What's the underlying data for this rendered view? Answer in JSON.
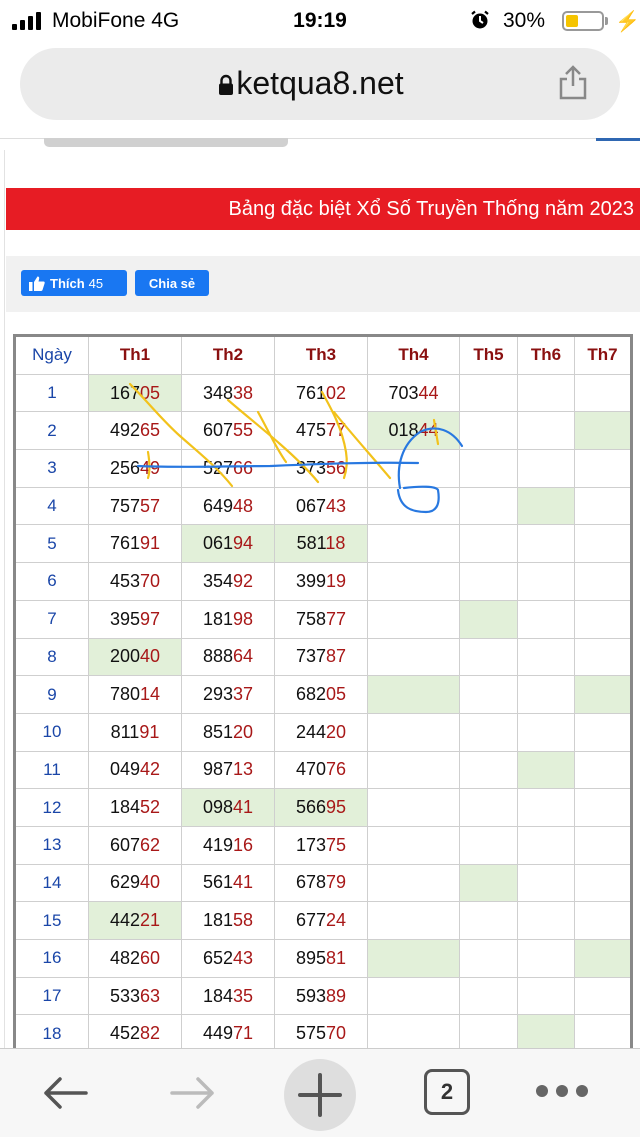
{
  "status_bar": {
    "carrier": "MobiFone   4G",
    "time": "19:19",
    "battery": "30%"
  },
  "browser": {
    "url": "ketqua8.net",
    "tab_count": "2"
  },
  "page": {
    "banner": "Bảng đặc biệt Xổ Số Truyền Thống năm 2023",
    "like_label": "Thích",
    "like_count": "45",
    "share_label": "Chia sẻ"
  },
  "table": {
    "headers": [
      "Ngày",
      "Th1",
      "Th2",
      "Th3",
      "Th4",
      "Th5",
      "Th6",
      "Th7"
    ],
    "highlight_color": "#e2f0d9",
    "rows": [
      {
        "day": "1",
        "values": [
          "16705",
          "34838",
          "76102",
          "70344",
          "",
          "",
          ""
        ],
        "hl": [
          1,
          0,
          0,
          0,
          0,
          0,
          0
        ]
      },
      {
        "day": "2",
        "values": [
          "49265",
          "60755",
          "47577",
          "01844",
          "",
          "",
          ""
        ],
        "hl": [
          0,
          0,
          0,
          1,
          0,
          0,
          1
        ]
      },
      {
        "day": "3",
        "values": [
          "25649",
          "52766",
          "37356",
          "",
          "",
          "",
          ""
        ],
        "hl": [
          0,
          0,
          0,
          0,
          0,
          0,
          0
        ]
      },
      {
        "day": "4",
        "values": [
          "75757",
          "64948",
          "06743",
          "",
          "",
          "",
          ""
        ],
        "hl": [
          0,
          0,
          0,
          0,
          0,
          1,
          0
        ]
      },
      {
        "day": "5",
        "values": [
          "76191",
          "06194",
          "58118",
          "",
          "",
          "",
          ""
        ],
        "hl": [
          0,
          1,
          1,
          0,
          0,
          0,
          0
        ]
      },
      {
        "day": "6",
        "values": [
          "45370",
          "35492",
          "39919",
          "",
          "",
          "",
          ""
        ],
        "hl": [
          0,
          0,
          0,
          0,
          0,
          0,
          0
        ]
      },
      {
        "day": "7",
        "values": [
          "39597",
          "18198",
          "75877",
          "",
          "",
          "",
          ""
        ],
        "hl": [
          0,
          0,
          0,
          0,
          1,
          0,
          0
        ]
      },
      {
        "day": "8",
        "values": [
          "20040",
          "88864",
          "73787",
          "",
          "",
          "",
          ""
        ],
        "hl": [
          1,
          0,
          0,
          0,
          0,
          0,
          0
        ]
      },
      {
        "day": "9",
        "values": [
          "78014",
          "29337",
          "68205",
          "",
          "",
          "",
          ""
        ],
        "hl": [
          0,
          0,
          0,
          1,
          0,
          0,
          1
        ]
      },
      {
        "day": "10",
        "values": [
          "81191",
          "85120",
          "24420",
          "",
          "",
          "",
          ""
        ],
        "hl": [
          0,
          0,
          0,
          0,
          0,
          0,
          0
        ]
      },
      {
        "day": "11",
        "values": [
          "04942",
          "98713",
          "47076",
          "",
          "",
          "",
          ""
        ],
        "hl": [
          0,
          0,
          0,
          0,
          0,
          1,
          0
        ]
      },
      {
        "day": "12",
        "values": [
          "18452",
          "09841",
          "56695",
          "",
          "",
          "",
          ""
        ],
        "hl": [
          0,
          1,
          1,
          0,
          0,
          0,
          0
        ]
      },
      {
        "day": "13",
        "values": [
          "60762",
          "41916",
          "17375",
          "",
          "",
          "",
          ""
        ],
        "hl": [
          0,
          0,
          0,
          0,
          0,
          0,
          0
        ]
      },
      {
        "day": "14",
        "values": [
          "62940",
          "56141",
          "67879",
          "",
          "",
          "",
          ""
        ],
        "hl": [
          0,
          0,
          0,
          0,
          1,
          0,
          0
        ]
      },
      {
        "day": "15",
        "values": [
          "44221",
          "18158",
          "67724",
          "",
          "",
          "",
          ""
        ],
        "hl": [
          1,
          0,
          0,
          0,
          0,
          0,
          0
        ]
      },
      {
        "day": "16",
        "values": [
          "48260",
          "65243",
          "89581",
          "",
          "",
          "",
          ""
        ],
        "hl": [
          0,
          0,
          0,
          1,
          0,
          0,
          1
        ]
      },
      {
        "day": "17",
        "values": [
          "53363",
          "18435",
          "59389",
          "",
          "",
          "",
          ""
        ],
        "hl": [
          0,
          0,
          0,
          0,
          0,
          0,
          0
        ]
      },
      {
        "day": "18",
        "values": [
          "45282",
          "44971",
          "57570",
          "",
          "",
          "",
          ""
        ],
        "hl": [
          0,
          0,
          0,
          0,
          0,
          1,
          0
        ]
      }
    ]
  }
}
